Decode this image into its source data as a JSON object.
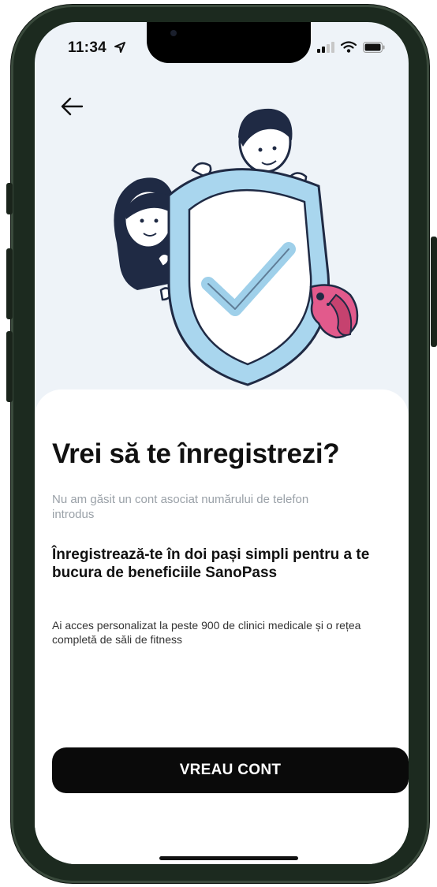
{
  "status_bar": {
    "time": "11:34",
    "icons": [
      "location-arrow-icon",
      "cellular-signal-icon",
      "wifi-icon",
      "battery-icon"
    ]
  },
  "navigation": {
    "back_icon": "back-arrow-icon"
  },
  "illustration": {
    "icon": "shield-checkmark-family-illustration"
  },
  "content": {
    "title": "Vrei să te înregistrezi?",
    "subtitle": "Nu am găsit un cont asociat numărului de telefon introdus",
    "heading": "Înregistrează-te în doi pași simpli pentru a te bucura de beneficiile SanoPass",
    "body": "Ai acces personalizat la peste 900 de clinici medicale și o rețea completă de săli de fitness"
  },
  "actions": {
    "primary_label": "VREAU CONT"
  },
  "colors": {
    "background": "#eef3f8",
    "sheet": "#ffffff",
    "button": "#0a0a0a",
    "button_text": "#ffffff",
    "shield": "#a9d6ee",
    "dog": "#e25a8c",
    "subtitle_text": "#9aa1a8"
  }
}
